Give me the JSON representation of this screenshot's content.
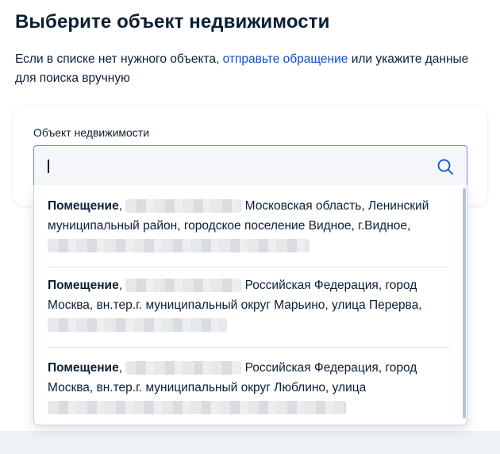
{
  "page": {
    "title": "Выберите объект недвижимости",
    "intro_prefix": "Если в списке нет нужного объекта, ",
    "intro_link": "отправьте обращение",
    "intro_suffix": " или укажите данные для поиска вручную"
  },
  "field": {
    "label": "Объект недвижимости",
    "value": "",
    "icon": "search-icon"
  },
  "options": [
    {
      "type": "Помещение",
      "sep": ", ",
      "address_line1": "Московская область, Ленинский",
      "address_rest": "муниципальный район, городское поселение Видное, г.Видное,"
    },
    {
      "type": "Помещение",
      "sep": ", ",
      "address_line1": "Российская Федерация, город",
      "address_rest": "Москва, вн.тер.г. муниципальный округ Марьино, улица Перерва,"
    },
    {
      "type": "Помещение",
      "sep": ", ",
      "address_line1": "Российская Федерация, город",
      "address_rest": "Москва, вн.тер.г. муниципальный округ Люблино, улица"
    }
  ],
  "colors": {
    "link": "#0d4cd3",
    "text": "#0b1f33",
    "focus_border": "#6b8bd3"
  }
}
